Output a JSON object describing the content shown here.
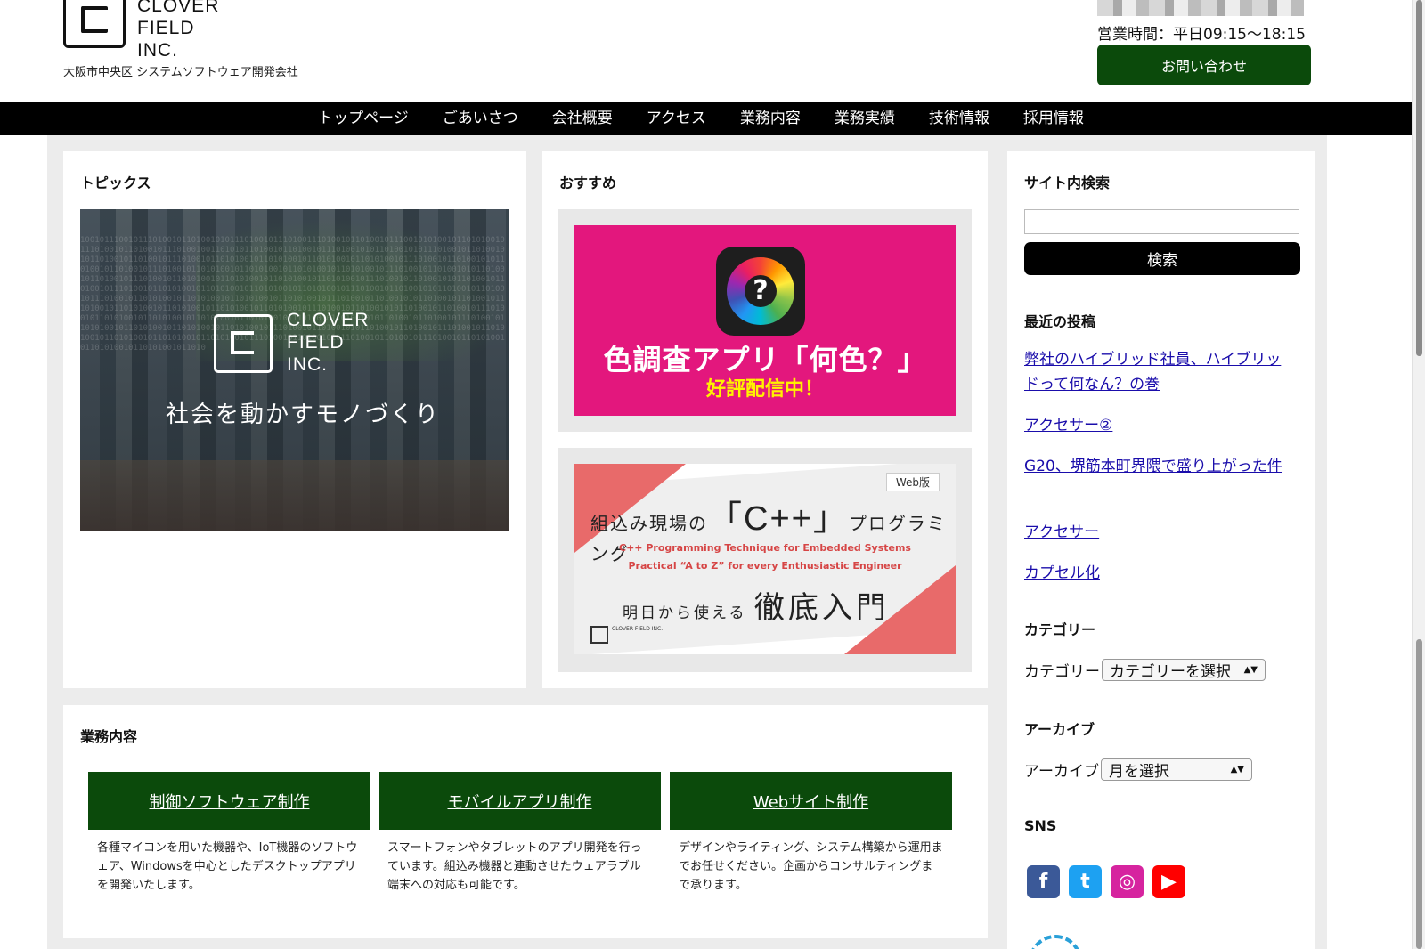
{
  "header": {
    "logo_text": [
      "CLOVER",
      "FIELD",
      "INC."
    ],
    "tagline": "大阪市中央区 システムソフトウェア開発会社",
    "hours": "営業時間：平日09:15〜18:15",
    "contact_label": "お問い合わせ"
  },
  "nav": {
    "items": [
      "トップページ",
      "ごあいさつ",
      "会社概要",
      "アクセス",
      "業務内容",
      "業務実績",
      "技術情報",
      "採用情報"
    ]
  },
  "topics": {
    "title": "トピックス",
    "image_logo": [
      "CLOVER",
      "FIELD",
      "INC."
    ],
    "image_slogan": "社会を動かすモノづくり"
  },
  "recommend": {
    "title": "おすすめ",
    "banner1": {
      "title": "色調査アプリ「何色？」",
      "subtitle": "好評配信中！",
      "icon_symbol": "?"
    },
    "banner2": {
      "badge": "Web版",
      "line1_pre": "組込み現場の",
      "line1_big": "「C++」",
      "line1_post": "プログラミング",
      "en1": "C++ Programming Technique for Embedded Systems",
      "en2": "Practical “A to Z” for every Enthusiastic Engineer",
      "line3_pre": "明日から使える",
      "line3_big": "徹底入門",
      "mini_logo": "CLOVER FIELD INC."
    }
  },
  "services": {
    "title": "業務内容",
    "items": [
      {
        "label": "制御ソフトウェア制作",
        "desc": "各種マイコンを用いた機器や、IoT機器のソフトウェア、Windowsを中心としたデスクトップアプリを開発いたします。"
      },
      {
        "label": "モバイルアプリ制作",
        "desc": "スマートフォンやタブレットのアプリ開発を行っています。組込み機器と連動させたウェアラブル端末への対応も可能です。"
      },
      {
        "label": "Webサイト制作",
        "desc": "デザインやライティング、システム構築から運用までお任せください。企画からコンサルティングまで承ります。"
      }
    ]
  },
  "sidebar": {
    "search_title": "サイト内検索",
    "search_value": "",
    "search_button": "検索",
    "recent_title": "最近の投稿",
    "recent_posts": [
      "弊社のハイブリッド社員、ハイブリッドって何なん？の巻",
      "アクセサー②",
      "G20、堺筋本町界隈で盛り上がった件",
      "アクセサー",
      "カプセル化"
    ],
    "category_title": "カテゴリー",
    "category_label": "カテゴリー",
    "category_value": "カテゴリーを選択",
    "archive_title": "アーカイブ",
    "archive_label": "アーカイブ",
    "archive_value": "月を選択",
    "sns_title": "SNS",
    "sns": [
      {
        "name": "facebook-icon",
        "glyph": "f",
        "color": "#3b5998"
      },
      {
        "name": "twitter-icon",
        "glyph": "t",
        "color": "#1da1f2"
      },
      {
        "name": "instagram-icon",
        "glyph": "◎",
        "color": "#d6249f"
      },
      {
        "name": "youtube-icon",
        "glyph": "▶",
        "color": "#ff0000"
      }
    ]
  },
  "colors": {
    "brand_green": "#0b4a0b",
    "nav_bg": "#000000",
    "link_blue": "#1a0dab",
    "banner_pink": "#e3177d"
  }
}
